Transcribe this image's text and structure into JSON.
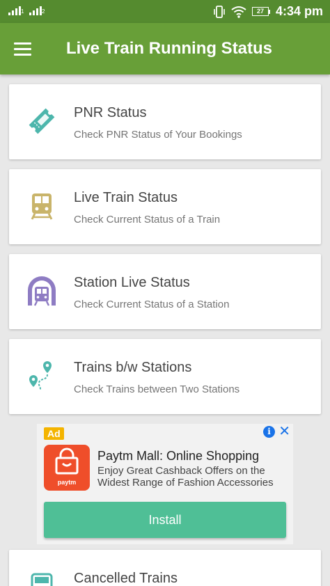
{
  "status_bar": {
    "sim1": "1",
    "sim2": "2",
    "battery": "27",
    "time": "4:34 pm"
  },
  "app_bar": {
    "title": "Live Train Running Status"
  },
  "menu": [
    {
      "icon": "ticket-icon",
      "title": "PNR Status",
      "subtitle": "Check PNR Status of Your Bookings",
      "color": "#4db6ac"
    },
    {
      "icon": "train-icon",
      "title": "Live Train Status",
      "subtitle": "Check Current Status of a Train",
      "color": "#c9b46a"
    },
    {
      "icon": "tunnel-train-icon",
      "title": "Station Live Status",
      "subtitle": "Check Current Status of a Station",
      "color": "#8e7cc3"
    },
    {
      "icon": "route-pin-icon",
      "title": "Trains b/w Stations",
      "subtitle": "Check Trains between Two Stations",
      "color": "#4db6ac"
    },
    {
      "icon": "train-icon",
      "title": "Cancelled Trains",
      "subtitle": "",
      "color": "#4db6ac"
    }
  ],
  "ad": {
    "badge": "Ad",
    "logo_text": "paytm",
    "title": "Paytm Mall: Online Shopping",
    "description": "Enjoy Great Cashback Offers on the Widest Range of Fashion Accessories",
    "button": "Install",
    "colors": {
      "badge": "#f4b400",
      "logo": "#ef4e2a",
      "button": "#4fbf96",
      "info": "#1a73e8"
    }
  },
  "colors": {
    "status_bar": "#558b2f",
    "app_bar": "#689f38",
    "background": "#e8e8e8"
  }
}
